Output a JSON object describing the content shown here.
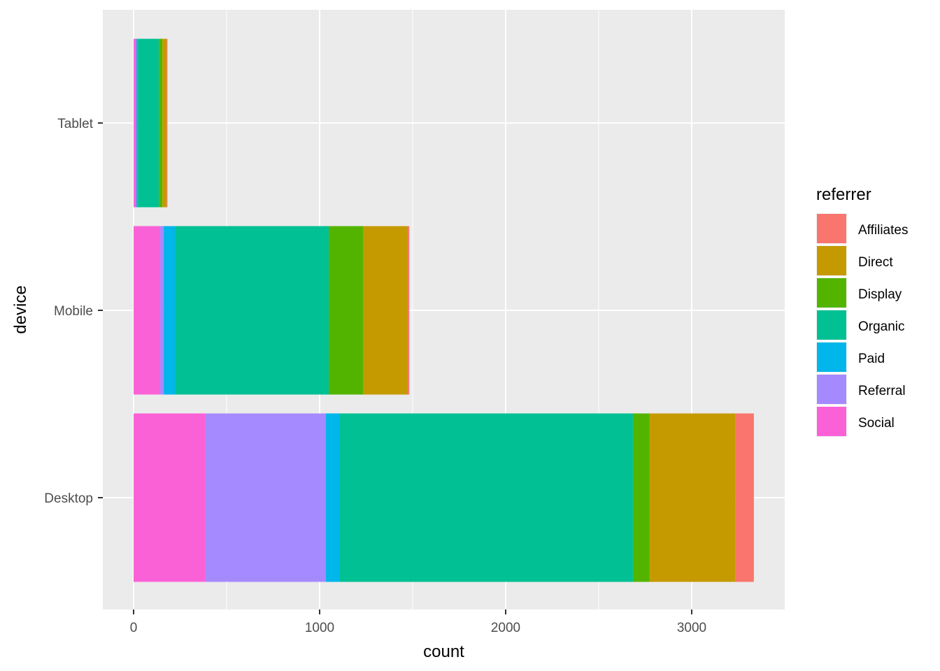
{
  "chart_data": {
    "type": "bar",
    "orientation": "horizontal",
    "stacked": true,
    "title": "",
    "xlabel": "count",
    "ylabel": "device",
    "xlim": [
      -165,
      3500
    ],
    "x_ticks": [
      0,
      1000,
      2000,
      3000
    ],
    "x_tick_labels": [
      "0",
      "1000",
      "2000",
      "3000"
    ],
    "grid": true,
    "categories": [
      "Desktop",
      "Mobile",
      "Tablet"
    ],
    "stack_order": [
      "Social",
      "Referral",
      "Paid",
      "Organic",
      "Display",
      "Direct",
      "Affiliates"
    ],
    "series": [
      {
        "name": "Affiliates",
        "color": "#F8766D",
        "values": [
          98,
          8,
          4
        ]
      },
      {
        "name": "Direct",
        "color": "#C49A00",
        "values": [
          462,
          241,
          23
        ]
      },
      {
        "name": "Display",
        "color": "#53B400",
        "values": [
          90,
          184,
          19
        ]
      },
      {
        "name": "Organic",
        "color": "#00C094",
        "values": [
          1575,
          827,
          113
        ]
      },
      {
        "name": "Paid",
        "color": "#00B6EB",
        "values": [
          75,
          60,
          8
        ]
      },
      {
        "name": "Referral",
        "color": "#A58AFF",
        "values": [
          647,
          19,
          0
        ]
      },
      {
        "name": "Social",
        "color": "#FB61D7",
        "values": [
          387,
          143,
          15
        ]
      }
    ],
    "legend": {
      "title": "referrer",
      "position": "right",
      "entries": [
        "Affiliates",
        "Direct",
        "Display",
        "Organic",
        "Paid",
        "Referral",
        "Social"
      ]
    }
  }
}
